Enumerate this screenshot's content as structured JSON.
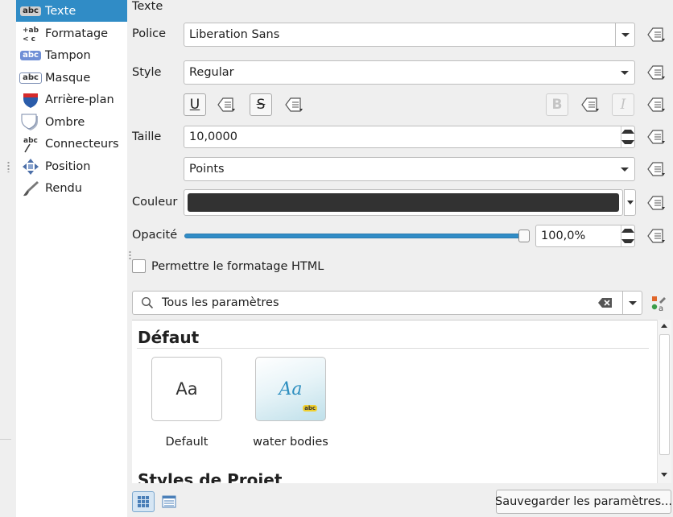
{
  "sidebar": {
    "items": [
      {
        "label": "Texte",
        "icon": "text-abc-icon"
      },
      {
        "label": "Formatage",
        "icon": "formatting-icon"
      },
      {
        "label": "Tampon",
        "icon": "buffer-icon"
      },
      {
        "label": "Masque",
        "icon": "mask-icon"
      },
      {
        "label": "Arrière-plan",
        "icon": "background-shield-icon"
      },
      {
        "label": "Ombre",
        "icon": "shadow-icon"
      },
      {
        "label": "Connecteurs",
        "icon": "callouts-icon"
      },
      {
        "label": "Position",
        "icon": "position-arrows-icon"
      },
      {
        "label": "Rendu",
        "icon": "rendering-brush-icon"
      }
    ],
    "active_index": 0
  },
  "form": {
    "section_title": "Texte",
    "font": {
      "label": "Police",
      "value": "Liberation Sans"
    },
    "style": {
      "label": "Style",
      "value": "Regular"
    },
    "toggles": {
      "underline": "U",
      "strikeout": "S",
      "bold": "B",
      "italic": "I"
    },
    "size": {
      "label": "Taille",
      "value": "10,0000",
      "unit": "Points"
    },
    "color": {
      "label": "Couleur",
      "value": "#323232"
    },
    "opacity": {
      "label": "Opacité",
      "value": "100,0%",
      "fraction": 1.0
    },
    "html_checkbox": {
      "label": "Permettre le formatage HTML",
      "checked": false
    }
  },
  "search": {
    "value": "Tous les paramètres"
  },
  "gallery": {
    "group_default": "Défaut",
    "tiles": [
      {
        "preview": "Aa",
        "caption": "Default"
      },
      {
        "preview": "Aa",
        "caption": "water bodies",
        "badge": "abc"
      }
    ],
    "group_project": "Styles de Projet"
  },
  "footer": {
    "save_button": "Sauvegarder les paramètres..."
  },
  "colors": {
    "accent": "#308cc6",
    "selection_text": "#ffffff",
    "swatch": "#323232"
  }
}
